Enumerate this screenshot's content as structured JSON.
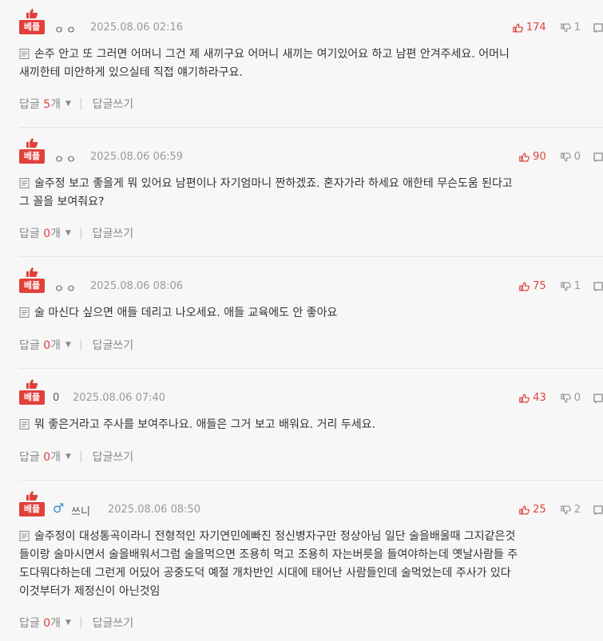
{
  "best_label": "베플",
  "reply_label": "답글",
  "reply_unit": "개",
  "write_reply_label": "답글쓰기",
  "colors": {
    "accent": "#e0413a",
    "muted": "#999999",
    "male": "#2e8fd6"
  },
  "icons": {
    "best": "thumbs-up-icon",
    "doc": "document-icon",
    "up": "thumbs-up-icon",
    "down": "thumbs-down-icon",
    "report": "flag-icon",
    "gender": "male-symbol-icon"
  },
  "comments": [
    {
      "nickname": "ㅇㅇ",
      "date": "2025.08.06 02:16",
      "up": "174",
      "down": "1",
      "lines": [
        "손주 안고 또 그러면 어머니 그건 제 새끼구요 어머니 새끼는 여기있어요 하고 남편 안겨주세요. 어머니",
        "새끼한테 미안하게 있으실테 직접 얘기하라구요."
      ],
      "reply_count": "5"
    },
    {
      "nickname": "ㅇㅇ",
      "date": "2025.08.06 06:59",
      "up": "90",
      "down": "0",
      "lines": [
        "술주정 보고 좋을게 뭐 있어요 남편이나 자기엄마니 짠하겠죠. 혼자가라 하세요 애한테 무슨도움 된다고",
        "그 꼴을 보여줘요?"
      ],
      "reply_count": "0"
    },
    {
      "nickname": "ㅇㅇ",
      "date": "2025.08.06 08:06",
      "up": "75",
      "down": "1",
      "lines": [
        "술 마신다 싶으면 애들 데리고 나오세요. 애들 교육에도 안 좋아요"
      ],
      "reply_count": "0"
    },
    {
      "nickname": "0",
      "date": "2025.08.06 07:40",
      "up": "43",
      "down": "0",
      "lines": [
        "뭐 좋은거라고 주사를 보여주나요. 애들은 그거 보고 배워요. 거리 두세요."
      ],
      "reply_count": "0"
    },
    {
      "gender": "♂",
      "nickname": "쓰니",
      "date": "2025.08.06 08:50",
      "up": "25",
      "down": "2",
      "lines": [
        "술주정이 대성통곡이라니 전형적인 자기연민에빠진 정신병자구만 정상아님 일단 술을배울때 그지같은것",
        "들이랑 술마시면서 술을배워서그럼 술을먹으면 조용히 먹고 조용히 자는버릇을 들여야하는데 옛날사람들 주",
        "도다뭐다하는데 그런게 어딨어 공중도덕 예절 개차반인 시대에 태어난 사람들인데 술먹었는데 주사가 있다",
        "이것부터가 제정신이 아닌것임"
      ],
      "reply_count": "0"
    }
  ]
}
